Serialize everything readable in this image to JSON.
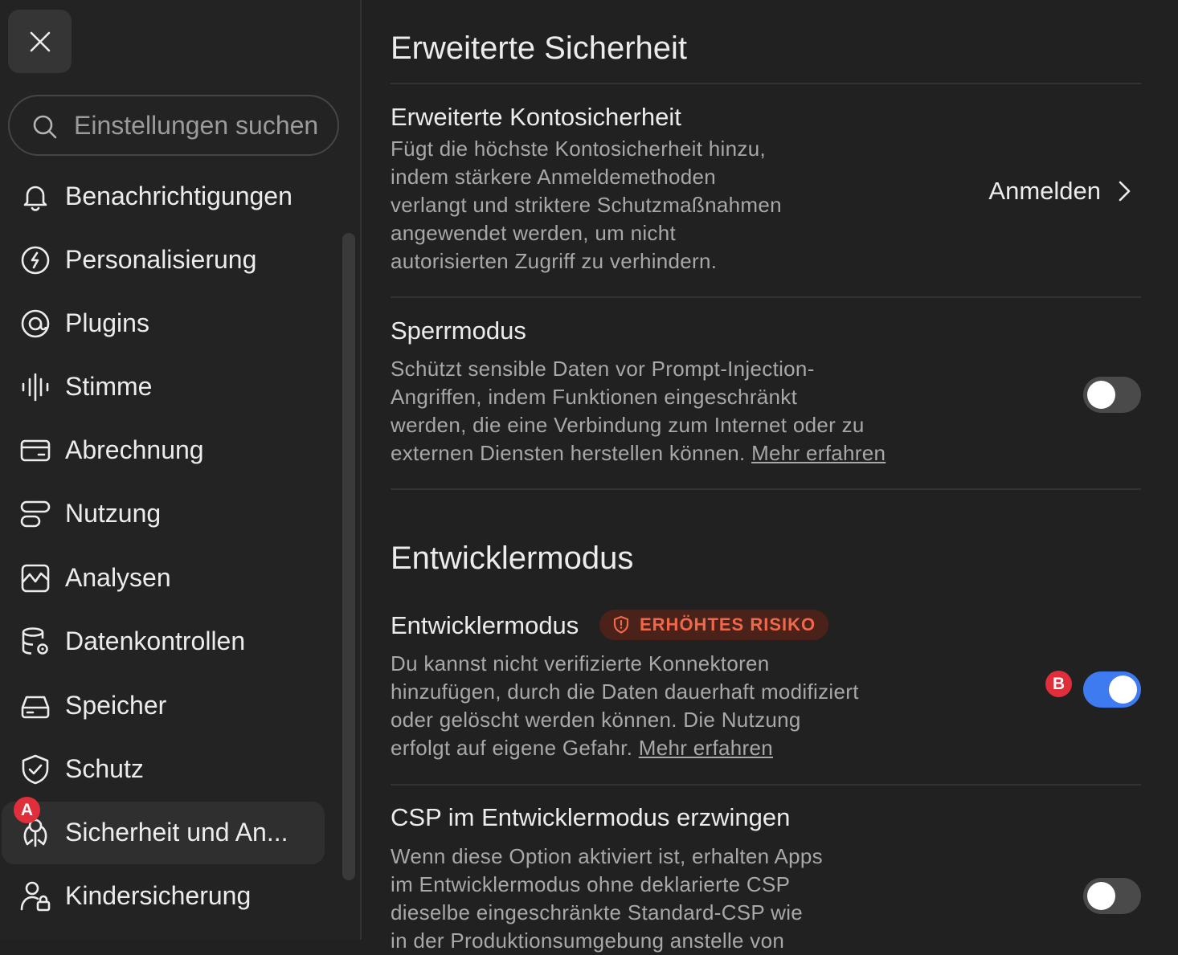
{
  "sidebar": {
    "search_placeholder": "Einstellungen suchen",
    "items": [
      {
        "label": "Benachrichtigungen",
        "icon": "bell-icon"
      },
      {
        "label": "Personalisierung",
        "icon": "personalization-icon"
      },
      {
        "label": "Plugins",
        "icon": "plugins-icon"
      },
      {
        "label": "Stimme",
        "icon": "voice-icon"
      },
      {
        "label": "Abrechnung",
        "icon": "credit-card-icon"
      },
      {
        "label": "Nutzung",
        "icon": "usage-icon"
      },
      {
        "label": "Analysen",
        "icon": "analytics-icon"
      },
      {
        "label": "Datenkontrollen",
        "icon": "database-gear-icon"
      },
      {
        "label": "Speicher",
        "icon": "storage-icon"
      },
      {
        "label": "Schutz",
        "icon": "shield-check-icon"
      },
      {
        "label": "Sicherheit und An...",
        "icon": "security-icon",
        "active": true
      },
      {
        "label": "Kindersicherung",
        "icon": "parental-control-icon"
      }
    ],
    "marker_a": "A"
  },
  "main": {
    "section1": {
      "title": "Erweiterte Sicherheit",
      "account": {
        "title": "Erweiterte Kontosicherheit",
        "desc_lines": [
          "Fügt die höchste Kontosicherheit hinzu,",
          "indem stärkere Anmeldemethoden",
          "verlangt und striktere Schutzmaßnahmen",
          "angewendet werden, um nicht",
          "autorisierten Zugriff zu verhindern."
        ],
        "action": "Anmelden"
      },
      "lock": {
        "title": "Sperrmodus",
        "desc_lines": [
          "Schützt sensible Daten vor Prompt-Injection-",
          "Angriffen, indem Funktionen eingeschränkt",
          "werden, die eine Verbindung zum Internet oder zu",
          "externen Diensten herstellen können."
        ],
        "link": "Mehr erfahren",
        "enabled": false
      }
    },
    "section2": {
      "title": "Entwicklermodus",
      "dev": {
        "title": "Entwicklermodus",
        "risk_badge": "ERHÖHTES RISIKO",
        "desc_lines": [
          "Du kannst nicht verifizierte Konnektoren",
          "hinzufügen, durch die Daten dauerhaft modifiziert",
          "oder gelöscht werden können. Die Nutzung",
          "erfolgt auf eigene Gefahr."
        ],
        "link": "Mehr erfahren",
        "enabled": true,
        "marker_b": "B"
      },
      "csp": {
        "title": "CSP im Entwicklermodus erzwingen",
        "desc_lines": [
          "Wenn diese Option aktiviert ist, erhalten Apps",
          "im Entwicklermodus ohne deklarierte CSP",
          "dieselbe eingeschränkte Standard-CSP wie",
          "in der Produktionsumgebung anstelle von"
        ],
        "enabled": false
      }
    }
  },
  "colors": {
    "background": "#212121",
    "sidebar": "#232323",
    "toggle_on": "#3e7bf0",
    "risk": "#f0684a",
    "marker": "#e02e3b"
  }
}
